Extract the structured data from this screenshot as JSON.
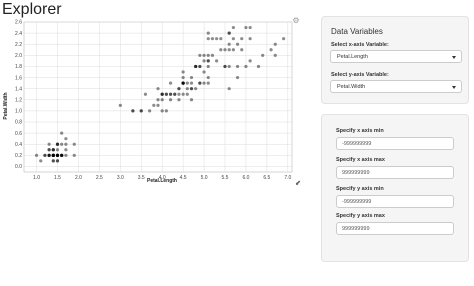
{
  "app": {
    "title": "Explorer"
  },
  "controls": {
    "panel_title": "Data Variables",
    "x_select": {
      "label": "Select x-axis Variable:",
      "value": "Petal.Length"
    },
    "y_select": {
      "label": "Select y-axis Variable:",
      "value": "Petal.Width"
    }
  },
  "limits": {
    "x_min": {
      "label": "Specify x axis min",
      "value": "-999999999"
    },
    "x_max": {
      "label": "Specify x axis max",
      "value": "999999999"
    },
    "y_min": {
      "label": "Specify y axis min",
      "value": "-999999999"
    },
    "y_max": {
      "label": "Specify y axis max",
      "value": "999999999"
    }
  },
  "icons": {
    "settings": "gear-icon",
    "resize": "resize-handle-icon"
  },
  "chart_data": {
    "type": "scatter",
    "xlabel": "Petal.Length",
    "ylabel": "Petal.Width",
    "xlim": [
      0.7,
      7.1
    ],
    "ylim": [
      -0.1,
      2.6
    ],
    "xticks": [
      "1.0",
      "1.5",
      "2.0",
      "2.5",
      "3.0",
      "3.5",
      "4.0",
      "4.5",
      "5.0",
      "5.5",
      "6.0",
      "6.5",
      "7.0"
    ],
    "yticks": [
      "0.0",
      "0.2",
      "0.4",
      "0.6",
      "0.8",
      "1.0",
      "1.2",
      "1.4",
      "1.6",
      "1.8",
      "2.0",
      "2.2",
      "2.4",
      "2.6"
    ],
    "grid": true,
    "point_color": "#000000",
    "points": [
      [
        1.4,
        0.2
      ],
      [
        1.4,
        0.2
      ],
      [
        1.3,
        0.2
      ],
      [
        1.5,
        0.2
      ],
      [
        1.4,
        0.2
      ],
      [
        1.7,
        0.4
      ],
      [
        1.4,
        0.3
      ],
      [
        1.5,
        0.2
      ],
      [
        1.4,
        0.2
      ],
      [
        1.5,
        0.1
      ],
      [
        1.5,
        0.2
      ],
      [
        1.6,
        0.2
      ],
      [
        1.4,
        0.1
      ],
      [
        1.1,
        0.1
      ],
      [
        1.2,
        0.2
      ],
      [
        1.5,
        0.4
      ],
      [
        1.3,
        0.4
      ],
      [
        1.4,
        0.3
      ],
      [
        1.7,
        0.3
      ],
      [
        1.5,
        0.3
      ],
      [
        1.7,
        0.2
      ],
      [
        1.5,
        0.4
      ],
      [
        1.0,
        0.2
      ],
      [
        1.7,
        0.5
      ],
      [
        1.9,
        0.2
      ],
      [
        1.6,
        0.2
      ],
      [
        1.6,
        0.4
      ],
      [
        1.5,
        0.2
      ],
      [
        1.4,
        0.2
      ],
      [
        1.6,
        0.2
      ],
      [
        1.6,
        0.2
      ],
      [
        1.5,
        0.4
      ],
      [
        1.5,
        0.1
      ],
      [
        1.4,
        0.2
      ],
      [
        1.5,
        0.2
      ],
      [
        1.2,
        0.2
      ],
      [
        1.3,
        0.2
      ],
      [
        1.4,
        0.1
      ],
      [
        1.3,
        0.2
      ],
      [
        1.5,
        0.2
      ],
      [
        1.3,
        0.3
      ],
      [
        1.3,
        0.3
      ],
      [
        1.3,
        0.2
      ],
      [
        1.6,
        0.6
      ],
      [
        1.9,
        0.4
      ],
      [
        1.4,
        0.3
      ],
      [
        1.6,
        0.2
      ],
      [
        1.4,
        0.2
      ],
      [
        1.5,
        0.2
      ],
      [
        1.4,
        0.2
      ],
      [
        4.7,
        1.4
      ],
      [
        4.5,
        1.5
      ],
      [
        4.9,
        1.5
      ],
      [
        4.0,
        1.3
      ],
      [
        4.6,
        1.5
      ],
      [
        4.5,
        1.3
      ],
      [
        4.7,
        1.6
      ],
      [
        3.3,
        1.0
      ],
      [
        4.6,
        1.3
      ],
      [
        3.9,
        1.4
      ],
      [
        3.5,
        1.0
      ],
      [
        4.2,
        1.5
      ],
      [
        4.0,
        1.0
      ],
      [
        4.7,
        1.4
      ],
      [
        3.6,
        1.3
      ],
      [
        4.4,
        1.4
      ],
      [
        4.5,
        1.5
      ],
      [
        4.1,
        1.0
      ],
      [
        4.5,
        1.5
      ],
      [
        3.9,
        1.1
      ],
      [
        4.8,
        1.8
      ],
      [
        4.0,
        1.3
      ],
      [
        4.9,
        1.5
      ],
      [
        4.7,
        1.2
      ],
      [
        4.3,
        1.3
      ],
      [
        4.4,
        1.4
      ],
      [
        4.8,
        1.4
      ],
      [
        5.0,
        1.7
      ],
      [
        4.5,
        1.5
      ],
      [
        3.5,
        1.0
      ],
      [
        3.8,
        1.1
      ],
      [
        3.7,
        1.0
      ],
      [
        3.9,
        1.2
      ],
      [
        5.1,
        1.6
      ],
      [
        4.5,
        1.5
      ],
      [
        4.5,
        1.6
      ],
      [
        4.7,
        1.5
      ],
      [
        4.4,
        1.3
      ],
      [
        4.1,
        1.3
      ],
      [
        4.0,
        1.3
      ],
      [
        4.4,
        1.2
      ],
      [
        4.6,
        1.4
      ],
      [
        4.0,
        1.2
      ],
      [
        3.3,
        1.0
      ],
      [
        4.2,
        1.3
      ],
      [
        4.2,
        1.2
      ],
      [
        4.2,
        1.3
      ],
      [
        4.3,
        1.3
      ],
      [
        3.0,
        1.1
      ],
      [
        4.1,
        1.3
      ],
      [
        6.0,
        2.5
      ],
      [
        5.1,
        1.9
      ],
      [
        5.9,
        2.1
      ],
      [
        5.6,
        1.8
      ],
      [
        5.8,
        2.2
      ],
      [
        6.6,
        2.1
      ],
      [
        4.5,
        1.7
      ],
      [
        6.3,
        1.8
      ],
      [
        5.8,
        1.8
      ],
      [
        6.1,
        2.5
      ],
      [
        5.1,
        2.0
      ],
      [
        5.3,
        1.9
      ],
      [
        5.5,
        2.1
      ],
      [
        5.0,
        2.0
      ],
      [
        5.1,
        2.4
      ],
      [
        5.3,
        2.3
      ],
      [
        5.5,
        1.8
      ],
      [
        6.7,
        2.2
      ],
      [
        6.9,
        2.3
      ],
      [
        5.0,
        1.5
      ],
      [
        5.7,
        2.3
      ],
      [
        4.9,
        2.0
      ],
      [
        6.7,
        2.0
      ],
      [
        4.9,
        1.8
      ],
      [
        5.7,
        2.1
      ],
      [
        6.0,
        1.8
      ],
      [
        4.8,
        1.8
      ],
      [
        4.9,
        1.8
      ],
      [
        5.6,
        2.1
      ],
      [
        5.8,
        1.6
      ],
      [
        6.1,
        1.9
      ],
      [
        6.4,
        2.0
      ],
      [
        5.6,
        2.2
      ],
      [
        5.1,
        1.5
      ],
      [
        5.6,
        1.4
      ],
      [
        6.1,
        2.3
      ],
      [
        5.6,
        2.4
      ],
      [
        5.5,
        1.8
      ],
      [
        4.8,
        1.8
      ],
      [
        5.4,
        2.1
      ],
      [
        5.6,
        2.4
      ],
      [
        5.1,
        2.3
      ],
      [
        5.1,
        1.9
      ],
      [
        5.9,
        2.3
      ],
      [
        5.7,
        2.5
      ],
      [
        5.2,
        2.3
      ],
      [
        5.0,
        1.9
      ],
      [
        5.2,
        2.0
      ],
      [
        5.4,
        2.3
      ],
      [
        5.1,
        1.8
      ]
    ]
  }
}
